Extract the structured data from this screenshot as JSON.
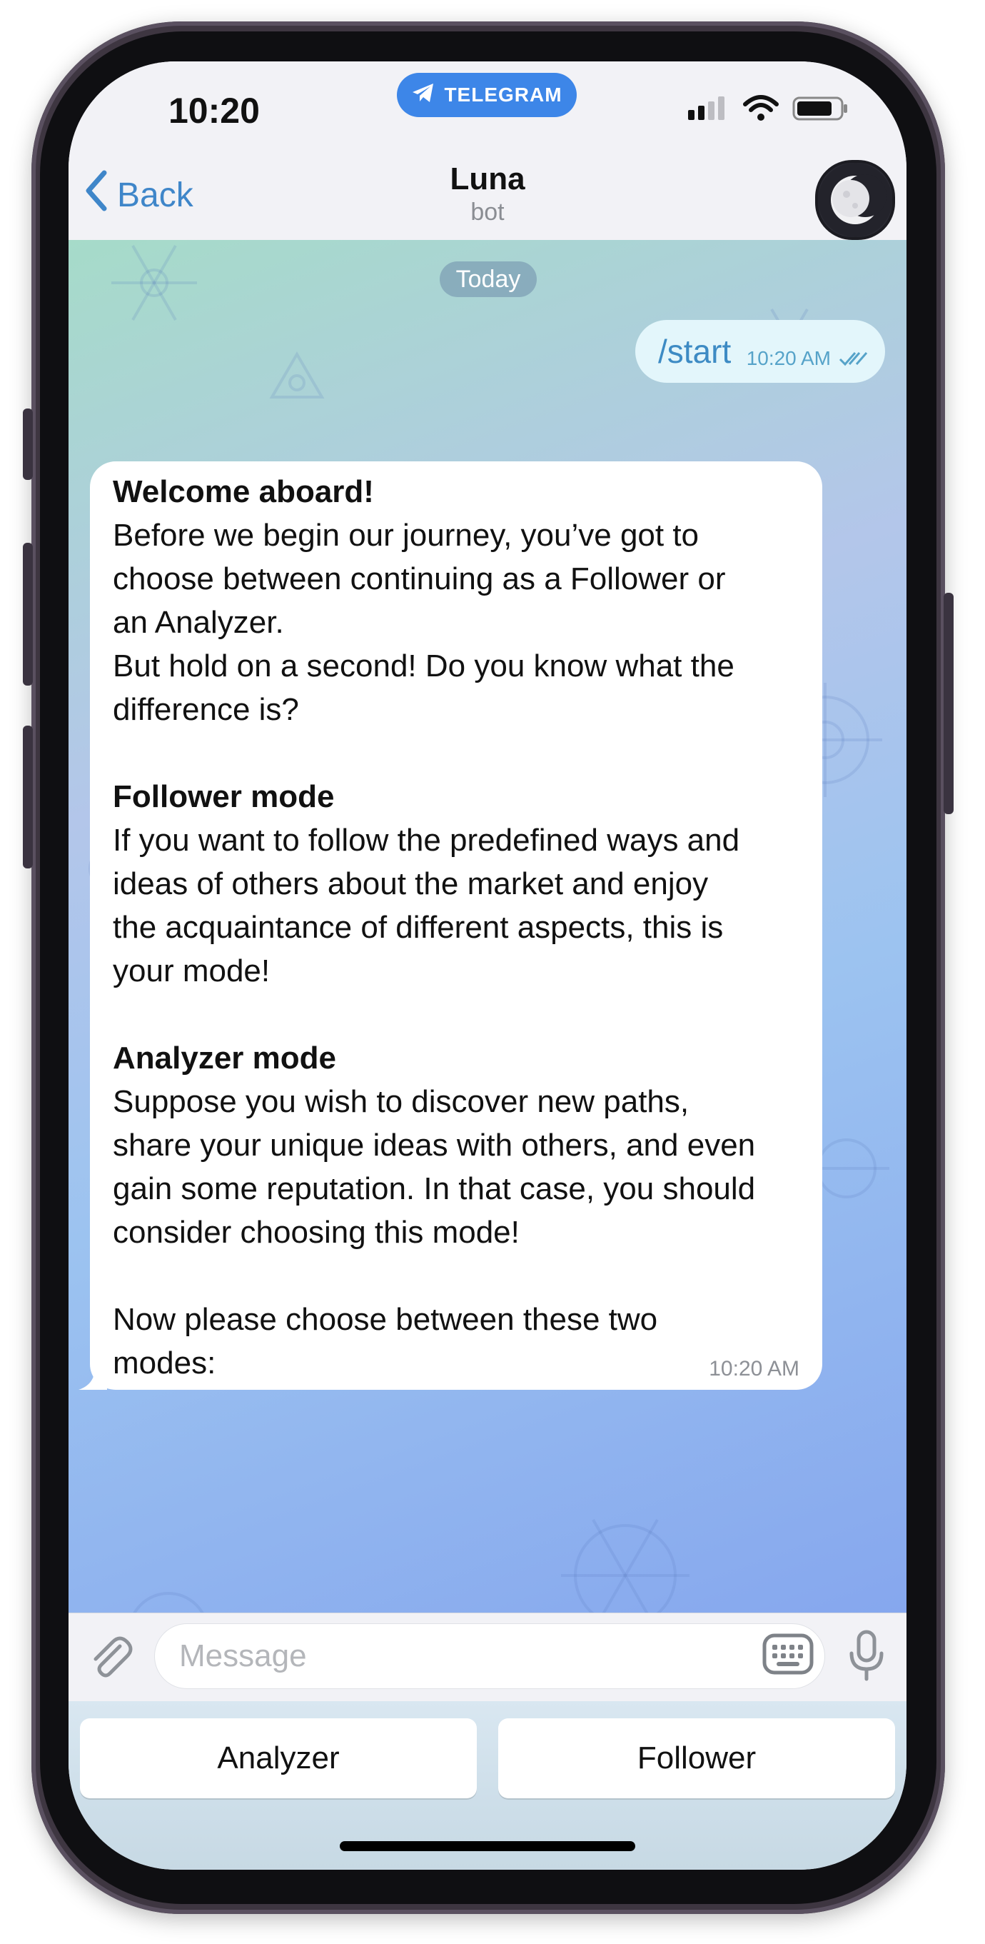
{
  "status_bar": {
    "time": "10:20",
    "telegram_badge": "TELEGRAM"
  },
  "header": {
    "back_label": "Back",
    "title": "Luna",
    "subtitle": "bot"
  },
  "chat": {
    "date_badge": "Today",
    "outgoing": {
      "text": "/start",
      "time": "10:20 AM"
    },
    "incoming": {
      "time": "10:20 AM",
      "lines": [
        {
          "text": "Welcome aboard!",
          "bold": true
        },
        {
          "text": "Before we begin our journey, you’ve got to",
          "bold": false
        },
        {
          "text": "choose between continuing as a Follower or",
          "bold": false
        },
        {
          "text": "an Analyzer.",
          "bold": false
        },
        {
          "text": "But hold on a second! Do you know what the",
          "bold": false
        },
        {
          "text": "difference is?",
          "bold": false
        },
        {
          "text": "",
          "bold": false
        },
        {
          "text": "Follower mode",
          "bold": true
        },
        {
          "text": "If you want to follow the predefined ways and",
          "bold": false
        },
        {
          "text": "ideas of others about the market and enjoy",
          "bold": false
        },
        {
          "text": "the acquaintance of different aspects, this is",
          "bold": false
        },
        {
          "text": "your mode!",
          "bold": false
        },
        {
          "text": "",
          "bold": false
        },
        {
          "text": "Analyzer mode",
          "bold": true
        },
        {
          "text": "Suppose you wish to discover new paths,",
          "bold": false
        },
        {
          "text": "share your unique ideas with others, and even",
          "bold": false
        },
        {
          "text": "gain some reputation. In that case, you should",
          "bold": false
        },
        {
          "text": "consider choosing this mode!",
          "bold": false
        },
        {
          "text": "",
          "bold": false
        },
        {
          "text": "Now please choose between these two",
          "bold": false
        },
        {
          "text": "modes:",
          "bold": false
        }
      ]
    }
  },
  "composer": {
    "placeholder": "Message"
  },
  "reply_keyboard": {
    "buttons": [
      "Analyzer",
      "Follower"
    ]
  },
  "colors": {
    "accent": "#3f86c9",
    "telegram_blue": "#3d86e8",
    "outgoing_bubble": "#e3f6fb"
  },
  "icons": [
    "telegram-plane-icon",
    "signal-icon",
    "wifi-icon",
    "battery-icon",
    "chevron-left-icon",
    "moon-avatar-icon",
    "paperclip-icon",
    "keyboard-icon",
    "microphone-icon",
    "double-check-icon"
  ]
}
